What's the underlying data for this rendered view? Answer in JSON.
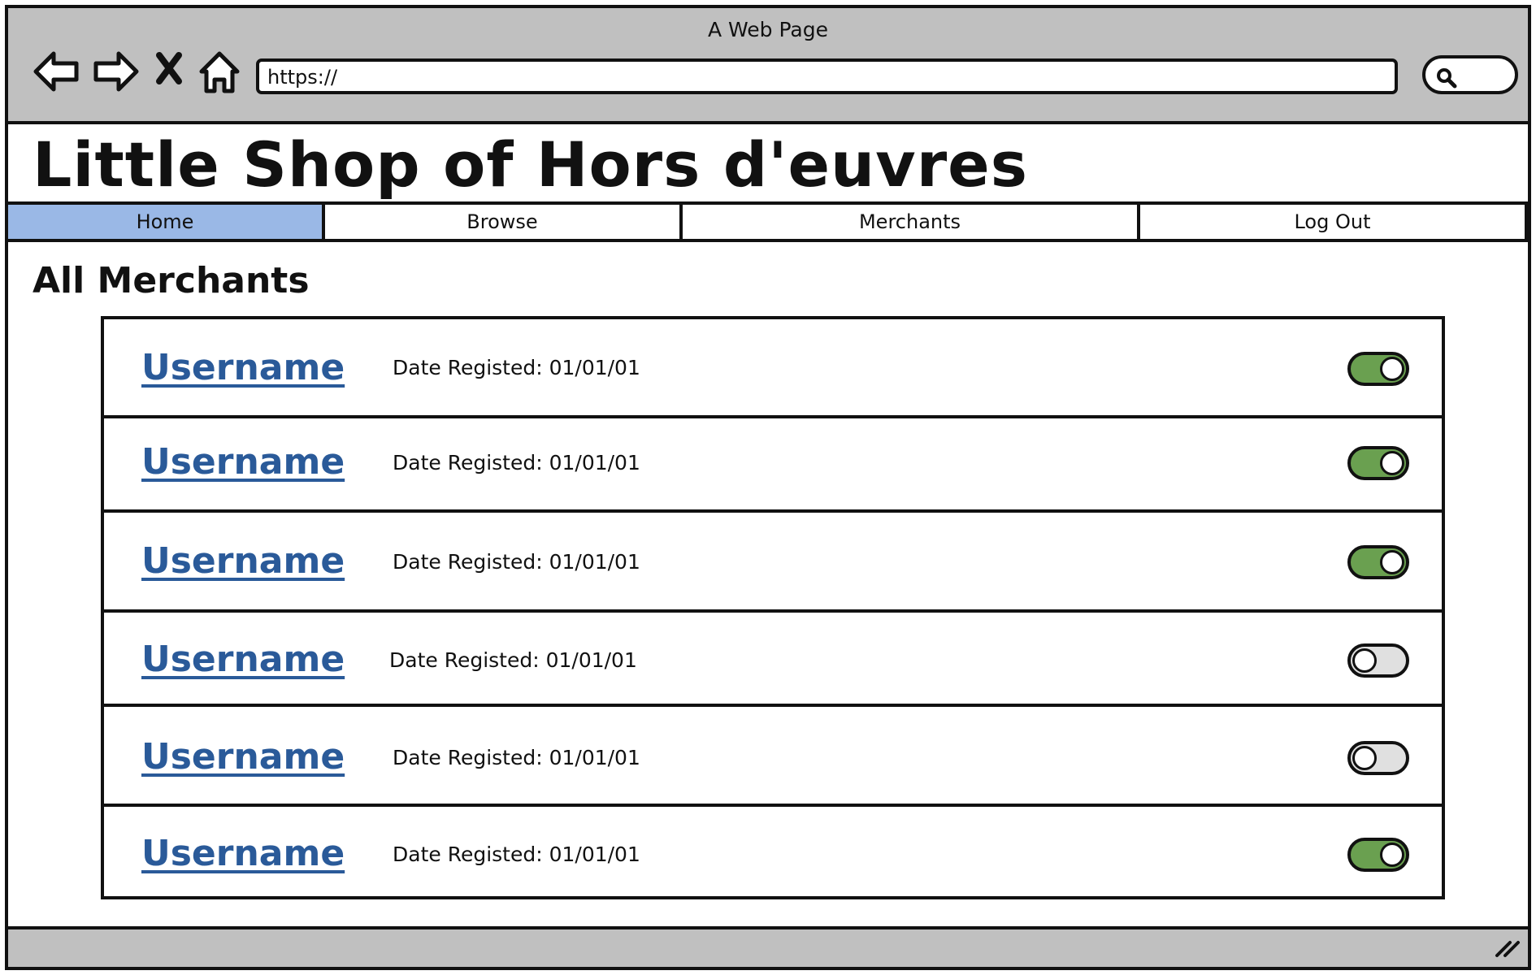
{
  "window": {
    "title": "A Web Page"
  },
  "address_bar": {
    "value": "https://"
  },
  "site": {
    "title": "Little Shop of Hors d'euvres"
  },
  "nav": {
    "tabs": [
      {
        "label": "Home",
        "active": true
      },
      {
        "label": "Browse",
        "active": false
      },
      {
        "label": "Merchants",
        "active": false
      },
      {
        "label": "Log Out",
        "active": false
      }
    ],
    "active_color": "#9ab8e6"
  },
  "main": {
    "heading": "All Merchants"
  },
  "merchants": [
    {
      "username": "Username",
      "date_text": "Date Registed: 01/01/01",
      "enabled": true
    },
    {
      "username": "Username",
      "date_text": "Date Registed: 01/01/01",
      "enabled": true
    },
    {
      "username": "Username",
      "date_text": "Date Registed: 01/01/01",
      "enabled": true
    },
    {
      "username": "Username",
      "date_text": "Date Registed: 01/01/01",
      "enabled": false
    },
    {
      "username": "Username",
      "date_text": "Date Registed: 01/01/01",
      "enabled": false
    },
    {
      "username": "Username",
      "date_text": "Date Registed: 01/01/01",
      "enabled": true
    }
  ],
  "colors": {
    "toggle_on": "#6aa050",
    "toggle_off": "#e0e0e0",
    "link": "#2a5a99",
    "chrome": "#c0c0c0"
  },
  "icons": {
    "back": "back-arrow-icon",
    "forward": "forward-arrow-icon",
    "stop": "close-icon",
    "home": "home-icon",
    "search": "search-icon",
    "resize": "resize-grip-icon"
  }
}
